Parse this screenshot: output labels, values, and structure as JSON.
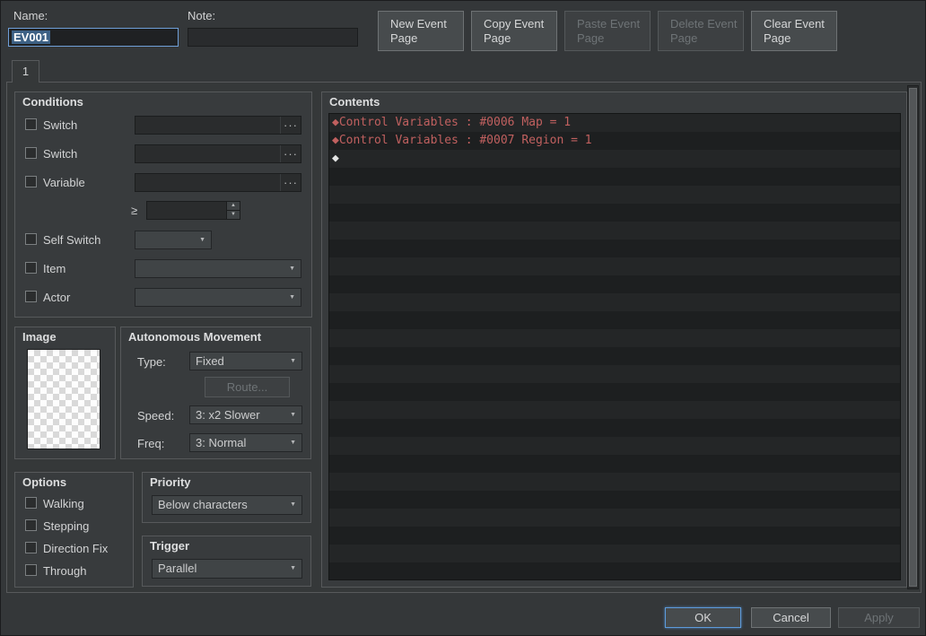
{
  "colors": {
    "command_red": "#c0605f",
    "selection_blue": "#3d6185",
    "focus_blue": "#6f9fd8"
  },
  "icons": {
    "ellipsis": "···",
    "dropdown_arrow": "▼",
    "spin_up": "▲",
    "spin_down": "▼"
  },
  "header": {
    "name_label": "Name:",
    "name_value": "EV001",
    "note_label": "Note:",
    "note_value": "",
    "buttons": {
      "new": "New Event Page",
      "copy": "Copy Event Page",
      "paste": "Paste Event Page",
      "delete": "Delete Event Page",
      "clear": "Clear Event Page"
    }
  },
  "tab": {
    "label": "1"
  },
  "conditions": {
    "title": "Conditions",
    "switch1_label": "Switch",
    "switch1_value": "",
    "switch2_label": "Switch",
    "switch2_value": "",
    "variable_label": "Variable",
    "variable_value": "",
    "variable_operator": "≥",
    "variable_amount": "",
    "self_switch_label": "Self Switch",
    "self_switch_value": "",
    "item_label": "Item",
    "item_value": "",
    "actor_label": "Actor",
    "actor_value": ""
  },
  "image_panel": {
    "title": "Image"
  },
  "movement": {
    "title": "Autonomous Movement",
    "type_label": "Type:",
    "type_value": "Fixed",
    "route_button": "Route...",
    "speed_label": "Speed:",
    "speed_value": "3: x2 Slower",
    "freq_label": "Freq:",
    "freq_value": "3: Normal"
  },
  "options": {
    "title": "Options",
    "items": [
      "Walking",
      "Stepping",
      "Direction Fix",
      "Through"
    ]
  },
  "priority": {
    "title": "Priority",
    "value": "Below characters"
  },
  "trigger": {
    "title": "Trigger",
    "value": "Parallel"
  },
  "contents": {
    "title": "Contents",
    "lines": [
      {
        "text": "◆Control Variables : #0006 Map = 1",
        "type": "command"
      },
      {
        "text": "◆Control Variables : #0007 Region = 1",
        "type": "command"
      },
      {
        "text": "◆",
        "type": "empty"
      }
    ]
  },
  "footer": {
    "ok": "OK",
    "cancel": "Cancel",
    "apply": "Apply"
  }
}
